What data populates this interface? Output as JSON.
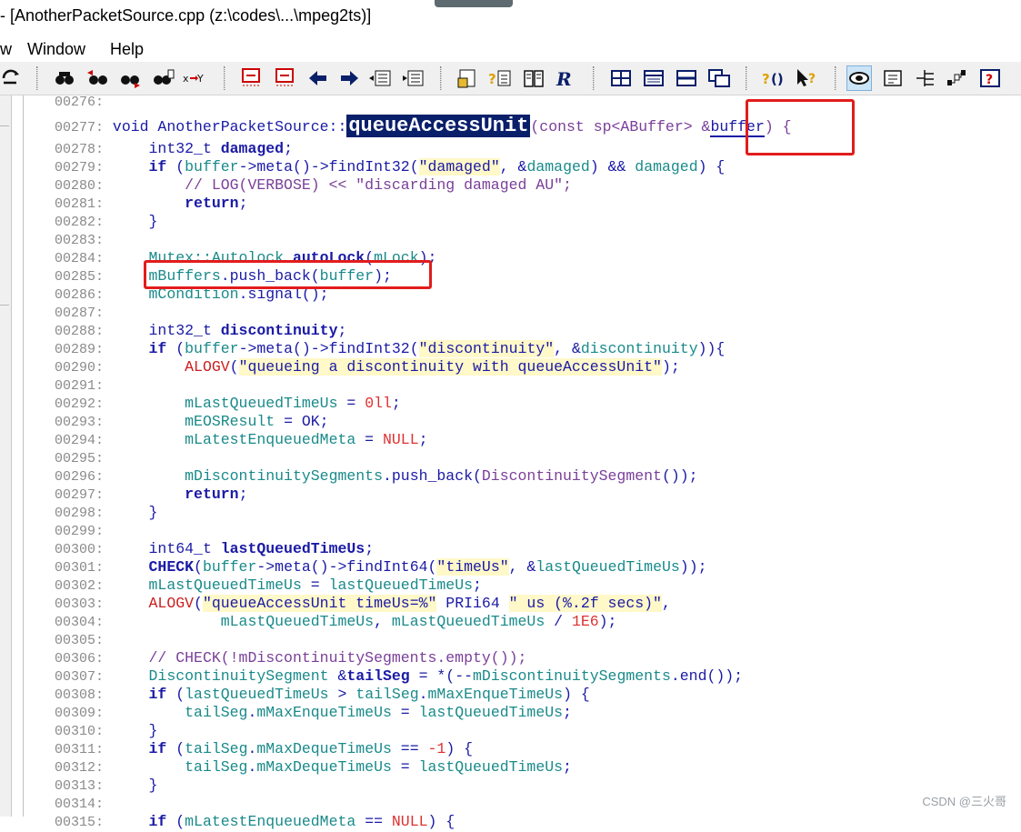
{
  "window": {
    "title": "- [AnotherPacketSource.cpp (z:\\codes\\...\\mpeg2ts)]"
  },
  "menu": {
    "items": [
      "w",
      "Window",
      "Help"
    ]
  },
  "toolbar": {
    "icons": [
      "refresh-icon",
      "find-icon",
      "find-prev-icon",
      "find-next-icon",
      "find-files-icon",
      "replace-icon",
      "bookmark-prev-icon",
      "bookmark-next-icon",
      "back-arrow-icon",
      "forward-arrow-icon",
      "indent-icon",
      "outdent-icon",
      "symbol-window-icon",
      "lookup-reference-icon",
      "book-icon",
      "relation-icon",
      "grid-icon",
      "panel-icon",
      "split-icon",
      "windows-icon",
      "context-help-icon",
      "help-pointer-icon",
      "eye-icon",
      "layout-icon",
      "tree-icon",
      "graph-icon",
      "help-index-icon"
    ]
  },
  "editor": {
    "lines": [
      {
        "n": "00276:",
        "t": ""
      },
      {
        "n": "00277:",
        "t": "void AnotherPacketSource::queueAccessUnit(const sp<ABuffer> &buffer) {"
      },
      {
        "n": "00278:",
        "t": "int32_t damaged;"
      },
      {
        "n": "00279:",
        "t": "if (buffer->meta()->findInt32(\"damaged\", &damaged) && damaged) {"
      },
      {
        "n": "00280:",
        "t": "// LOG(VERBOSE) << \"discarding damaged AU\";"
      },
      {
        "n": "00281:",
        "t": "return;"
      },
      {
        "n": "00282:",
        "t": "}"
      },
      {
        "n": "00283:",
        "t": ""
      },
      {
        "n": "00284:",
        "t": "Mutex::Autolock autoLock(mLock);"
      },
      {
        "n": "00285:",
        "t": "mBuffers.push_back(buffer);"
      },
      {
        "n": "00286:",
        "t": "mCondition.signal();"
      },
      {
        "n": "00287:",
        "t": ""
      },
      {
        "n": "00288:",
        "t": "int32_t discontinuity;"
      },
      {
        "n": "00289:",
        "t": "if (buffer->meta()->findInt32(\"discontinuity\", &discontinuity)){"
      },
      {
        "n": "00290:",
        "t": "ALOGV(\"queueing a discontinuity with queueAccessUnit\");"
      },
      {
        "n": "00291:",
        "t": ""
      },
      {
        "n": "00292:",
        "t": "mLastQueuedTimeUs = 0ll;"
      },
      {
        "n": "00293:",
        "t": "mEOSResult = OK;"
      },
      {
        "n": "00294:",
        "t": "mLatestEnqueuedMeta = NULL;"
      },
      {
        "n": "00295:",
        "t": ""
      },
      {
        "n": "00296:",
        "t": "mDiscontinuitySegments.push_back(DiscontinuitySegment());"
      },
      {
        "n": "00297:",
        "t": "return;"
      },
      {
        "n": "00298:",
        "t": "}"
      },
      {
        "n": "00299:",
        "t": ""
      },
      {
        "n": "00300:",
        "t": "int64_t lastQueuedTimeUs;"
      },
      {
        "n": "00301:",
        "t": "CHECK(buffer->meta()->findInt64(\"timeUs\", &lastQueuedTimeUs));"
      },
      {
        "n": "00302:",
        "t": "mLastQueuedTimeUs = lastQueuedTimeUs;"
      },
      {
        "n": "00303:",
        "t": "ALOGV(\"queueAccessUnit timeUs=%\" PRIi64 \" us (%.2f secs)\","
      },
      {
        "n": "00304:",
        "t": "mLastQueuedTimeUs, mLastQueuedTimeUs / 1E6);"
      },
      {
        "n": "00305:",
        "t": ""
      },
      {
        "n": "00306:",
        "t": "// CHECK(!mDiscontinuitySegments.empty());"
      },
      {
        "n": "00307:",
        "t": "DiscontinuitySegment &tailSeg = *(--mDiscontinuitySegments.end());"
      },
      {
        "n": "00308:",
        "t": "if (lastQueuedTimeUs > tailSeg.mMaxEnqueTimeUs) {"
      },
      {
        "n": "00309:",
        "t": "tailSeg.mMaxEnqueTimeUs = lastQueuedTimeUs;"
      },
      {
        "n": "00310:",
        "t": "}"
      },
      {
        "n": "00311:",
        "t": "if (tailSeg.mMaxDequeTimeUs == -1) {"
      },
      {
        "n": "00312:",
        "t": "tailSeg.mMaxDequeTimeUs = lastQueuedTimeUs;"
      },
      {
        "n": "00313:",
        "t": "}"
      },
      {
        "n": "00314:",
        "t": ""
      },
      {
        "n": "00315:",
        "t": "if (mLatestEnqueuedMeta == NULL) {"
      }
    ]
  },
  "watermark": "CSDN @三火哥",
  "colors": {
    "highlight_box": "#e21c1c",
    "selected_function_bg": "#0a1f6a",
    "keyword": "#1a1aa6",
    "comment": "#7a3f99",
    "string_bg": "#fff8c8",
    "number": "#e03030"
  }
}
